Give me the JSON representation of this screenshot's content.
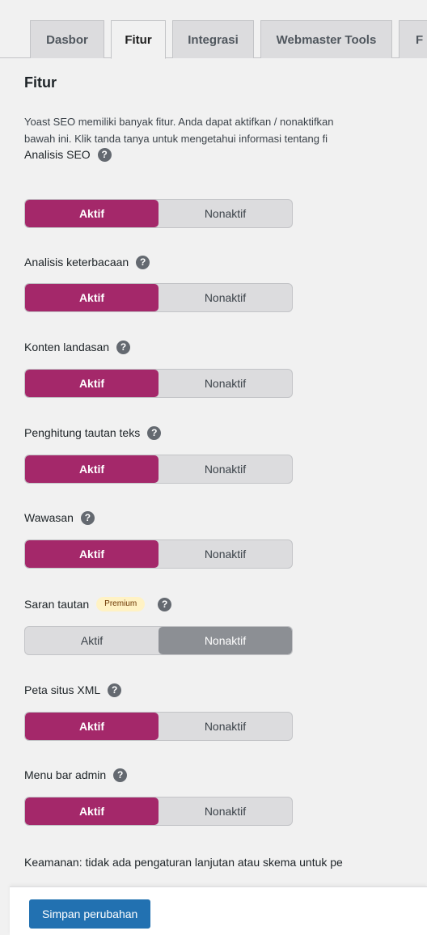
{
  "tabs": [
    {
      "label": "Dasbor"
    },
    {
      "label": "Fitur"
    },
    {
      "label": "Integrasi"
    },
    {
      "label": "Webmaster Tools"
    },
    {
      "label": "F"
    }
  ],
  "section": {
    "title": "Fitur",
    "description_line1": "Yoast SEO memiliki banyak fitur. Anda dapat aktifkan / nonaktifkan",
    "description_line2": "bawah ini. Klik tanda tanya untuk mengetahui informasi tentang fi"
  },
  "features": [
    {
      "label": "Analisis SEO",
      "on": "Aktif",
      "off": "Nonaktif",
      "state": "on"
    },
    {
      "label": "Analisis keterbacaan",
      "on": "Aktif",
      "off": "Nonaktif",
      "state": "on"
    },
    {
      "label": "Konten landasan",
      "on": "Aktif",
      "off": "Nonaktif",
      "state": "on"
    },
    {
      "label": "Penghitung tautan teks",
      "on": "Aktif",
      "off": "Nonaktif",
      "state": "on"
    },
    {
      "label": "Wawasan",
      "on": "Aktif",
      "off": "Nonaktif",
      "state": "on"
    },
    {
      "label": "Saran tautan",
      "badge": "Premium",
      "on": "Aktif",
      "off": "Nonaktif",
      "state": "off"
    },
    {
      "label": "Peta situs XML",
      "on": "Aktif",
      "off": "Nonaktif",
      "state": "on"
    },
    {
      "label": "Menu bar admin",
      "on": "Aktif",
      "off": "Nonaktif",
      "state": "on"
    }
  ],
  "footer_note": "Keamanan: tidak ada pengaturan lanjutan atau skema untuk pe",
  "save_button": "Simpan perubahan",
  "colors": {
    "active_toggle": "#a4286a",
    "disabled_selected": "#8c8f94",
    "primary_button": "#2271b1",
    "premium_badge": "#fff2c4"
  }
}
